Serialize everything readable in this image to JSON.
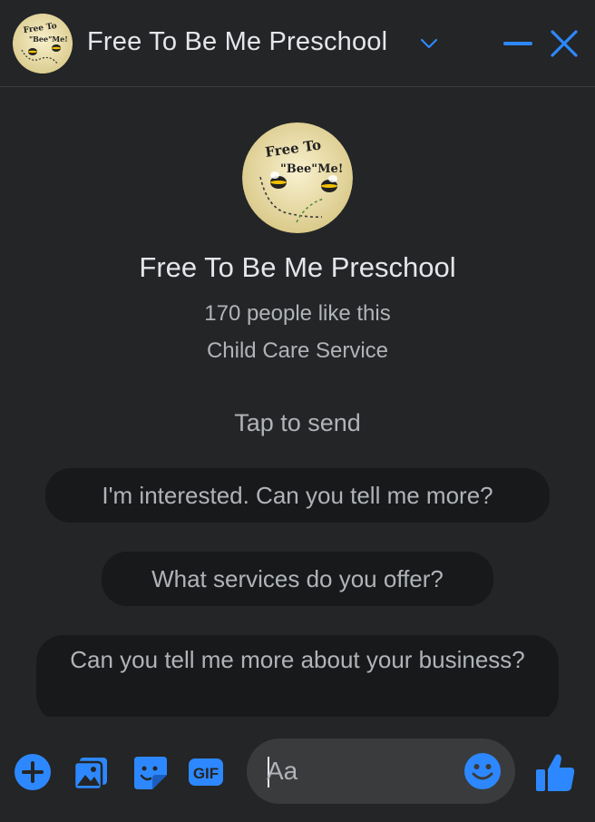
{
  "header": {
    "title": "Free To Be Me Preschool"
  },
  "profile": {
    "name": "Free To Be Me Preschool",
    "likes": "170 people like this",
    "category": "Child Care Service",
    "logo_text_line1": "Free To",
    "logo_text_line2": "\"Bee\"Me!"
  },
  "prompt": {
    "tap_label": "Tap to send",
    "suggestions": [
      "I'm interested. Can you tell me more?",
      "What services do you offer?",
      "Can you tell me more about your business?"
    ]
  },
  "composer": {
    "placeholder": "Aa",
    "gif_label": "GIF"
  },
  "colors": {
    "accent": "#2d88ff",
    "background": "#242526",
    "chip": "#18191a",
    "input": "#3a3b3c",
    "text_primary": "#e4e6eb",
    "text_secondary": "#b0b3b8"
  },
  "icons": [
    "chevron-down-icon",
    "minimize-icon",
    "close-icon",
    "plus-icon",
    "photo-icon",
    "sticker-icon",
    "gif-icon",
    "emoji-icon",
    "thumbs-up-icon"
  ]
}
